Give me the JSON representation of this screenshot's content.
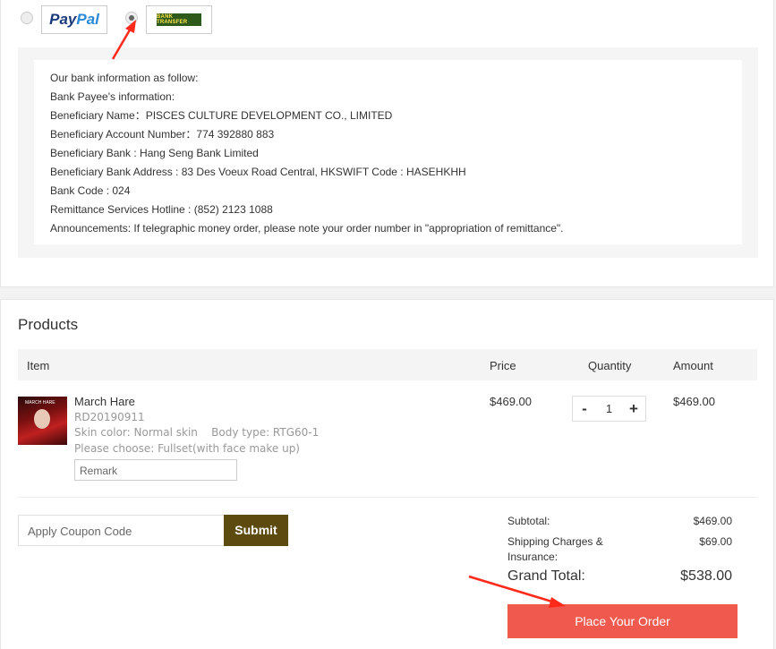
{
  "payment": {
    "paypal_label_pay": "Pay",
    "paypal_label_pal": "Pal",
    "bank_logo_text": "BANK TRANSFER",
    "bank_info": [
      "Our bank information as follow:",
      "Bank Payee's information:",
      "Beneficiary Name：PISCES CULTURE DEVELOPMENT CO., LIMITED",
      "Beneficiary Account Number：774 392880 883",
      "Beneficiary Bank : Hang Seng Bank Limited",
      "Beneficiary Bank Address : 83 Des Voeux Road Central, HKSWIFT Code : HASEHKHH",
      "Bank Code : 024",
      "Remittance Services Hotline : (852) 2123 1088",
      "Announcements: If telegraphic money order, please note your order number in \"appropriation of remittance\"."
    ]
  },
  "products": {
    "title": "Products",
    "columns": {
      "item": "Item",
      "price": "Price",
      "quantity": "Quantity",
      "amount": "Amount"
    },
    "item": {
      "thumb_text": "MARCH HARE",
      "name": "March Hare",
      "sku": "RD20190911",
      "skin": "Skin color: Normal skin",
      "body": "Body type: RTG60-1",
      "choice": "Please choose: Fullset(with face make up)",
      "remark_placeholder": "Remark",
      "price": "$469.00",
      "qty_minus": "-",
      "qty": "1",
      "qty_plus": "+",
      "amount": "$469.00"
    }
  },
  "coupon": {
    "placeholder": "Apply Coupon Code",
    "submit": "Submit"
  },
  "summary": {
    "subtotal_label": "Subtotal:",
    "subtotal": "$469.00",
    "shipping_label_1": "Shipping Charges &",
    "shipping_label_2": "Insurance:",
    "shipping": "$69.00",
    "grand_label": "Grand Total:",
    "grand": "$538.00",
    "place_order": "Place Your Order"
  },
  "colors": {
    "accent": "#f05a4e",
    "submit": "#5c4a0e",
    "annotation": "#ff2a1a"
  }
}
